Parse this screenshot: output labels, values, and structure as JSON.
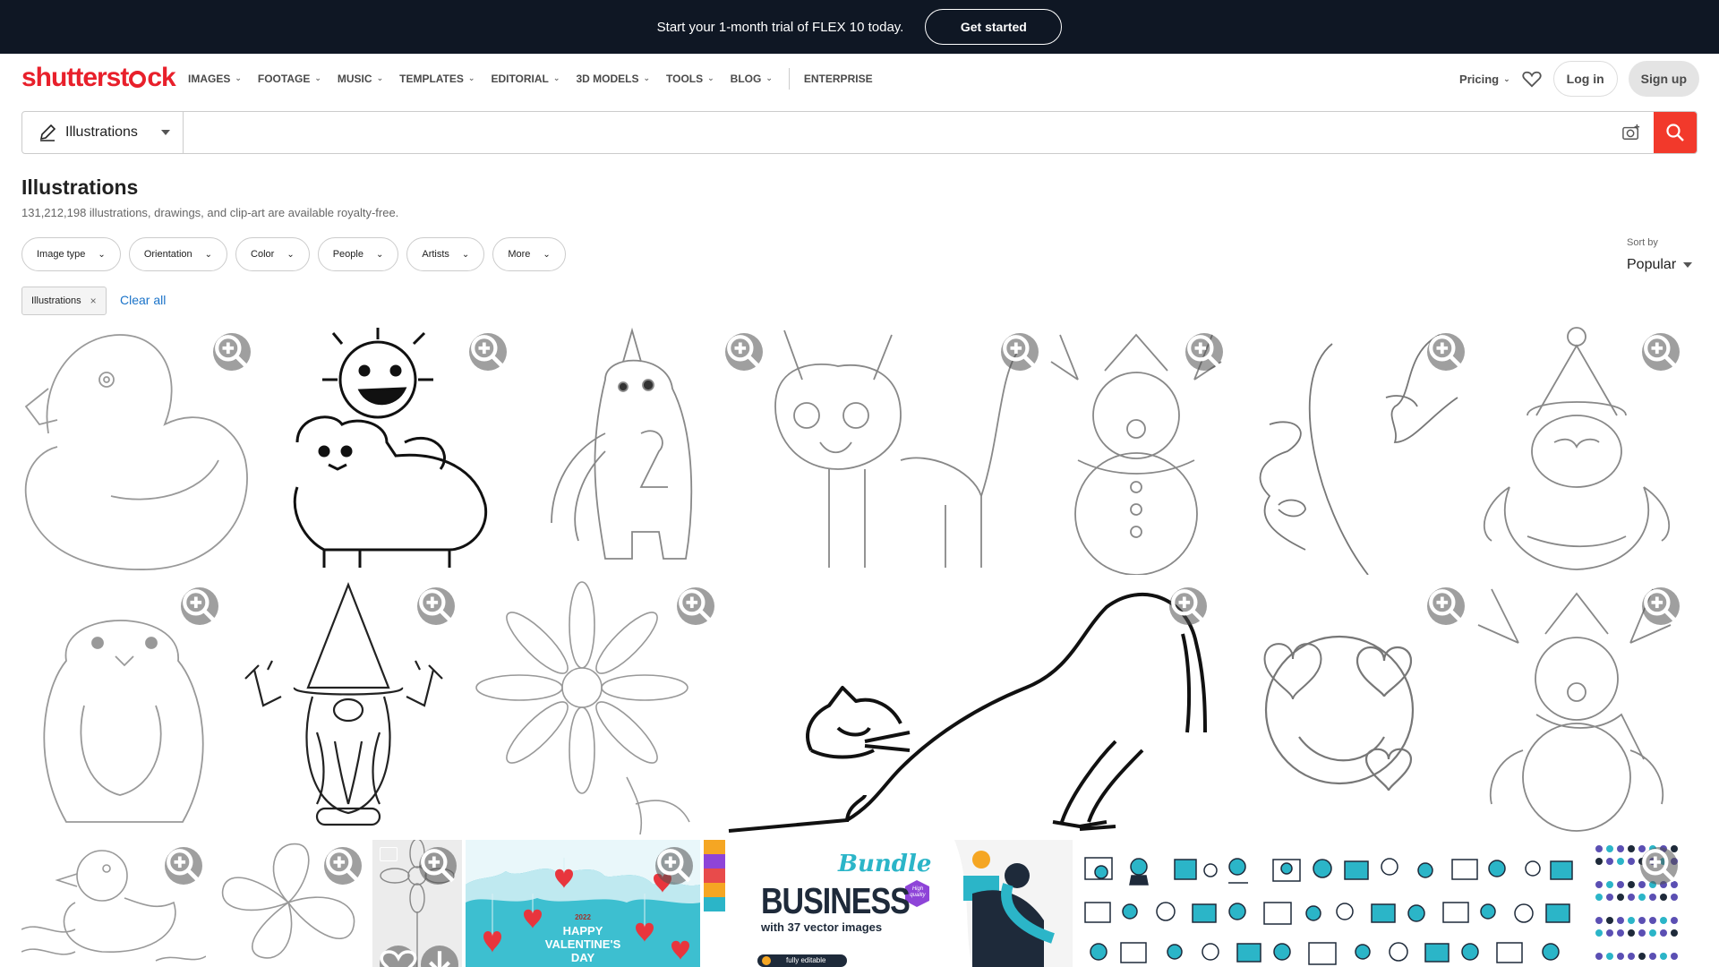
{
  "promo": {
    "text": "Start your 1-month trial of FLEX 10 today.",
    "cta": "Get started"
  },
  "brand": {
    "logo_left": "shutterst",
    "logo_right": "ck"
  },
  "nav": {
    "items": [
      {
        "label": "IMAGES"
      },
      {
        "label": "FOOTAGE"
      },
      {
        "label": "MUSIC"
      },
      {
        "label": "TEMPLATES"
      },
      {
        "label": "EDITORIAL"
      },
      {
        "label": "3D MODELS"
      },
      {
        "label": "TOOLS"
      },
      {
        "label": "BLOG"
      }
    ],
    "enterprise": "ENTERPRISE",
    "pricing": "Pricing",
    "login": "Log in",
    "signup": "Sign up"
  },
  "search": {
    "type": "Illustrations",
    "value": ""
  },
  "page": {
    "title": "Illustrations",
    "subtitle": "131,212,198 illustrations, drawings, and clip-art are available royalty-free."
  },
  "filters": [
    "Image type",
    "Orientation",
    "Color",
    "People",
    "Artists",
    "More"
  ],
  "sort": {
    "label": "Sort by",
    "value": "Popular"
  },
  "active_filter": {
    "label": "Illustrations",
    "clear": "Clear all"
  },
  "tiles": {
    "valentine": {
      "year": "2022",
      "line1": "HAPPY",
      "line2": "VALENTINE'S",
      "line3": "DAY"
    },
    "business": {
      "script": "Bundle",
      "title": "BUSINESS",
      "sub": "with 37 vector images",
      "badge": "fully editable",
      "sticker": "High quality"
    }
  },
  "colors": {
    "brand_red": "#e8202b",
    "search_red": "#f2392b",
    "promo_bg": "#0f1724",
    "link_blue": "#1a73c9",
    "teal": "#2bb5c8"
  }
}
